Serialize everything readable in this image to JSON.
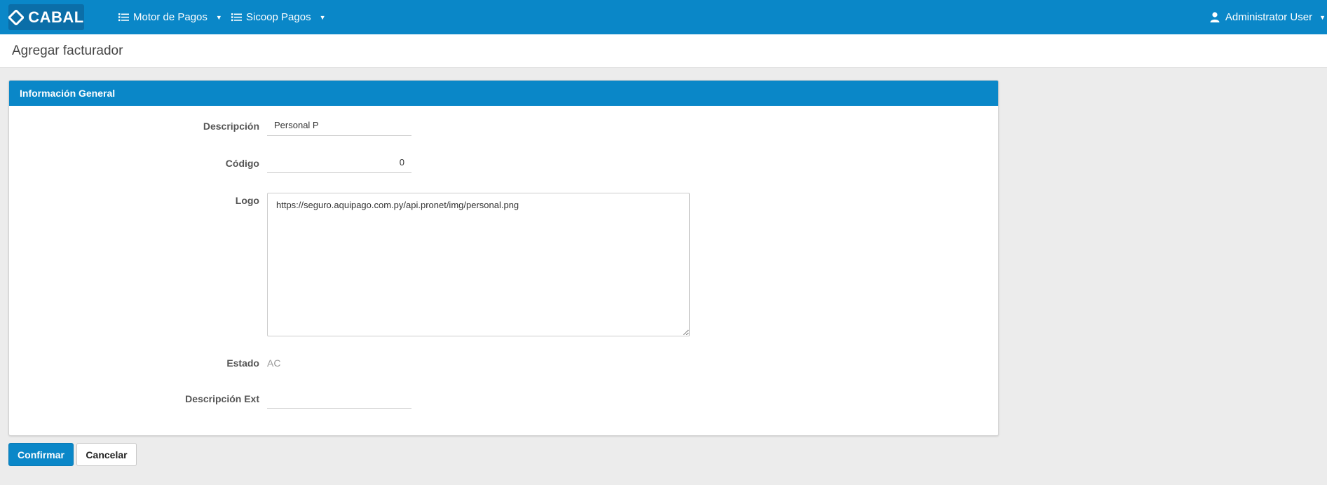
{
  "navbar": {
    "brand": "CABAL",
    "menus": [
      {
        "label": "Motor de Pagos",
        "icon": "list-icon"
      },
      {
        "label": "Sicoop Pagos",
        "icon": "list-icon"
      }
    ],
    "user": {
      "label": "Administrator User",
      "icon": "user-icon"
    }
  },
  "page": {
    "title": "Agregar facturador"
  },
  "panel": {
    "heading": "Información General",
    "fields": {
      "descripcion": {
        "label": "Descripción",
        "value": "Personal P"
      },
      "codigo": {
        "label": "Código",
        "value": "0"
      },
      "logo": {
        "label": "Logo",
        "value": "https://seguro.aquipago.com.py/api.pronet/img/personal.png"
      },
      "estado": {
        "label": "Estado",
        "value": "AC"
      },
      "descripcion_ext": {
        "label": "Descripción Ext",
        "value": ""
      }
    }
  },
  "actions": {
    "confirm": "Confirmar",
    "cancel": "Cancelar"
  },
  "colors": {
    "primary": "#0a87c8",
    "background": "#ececec"
  }
}
